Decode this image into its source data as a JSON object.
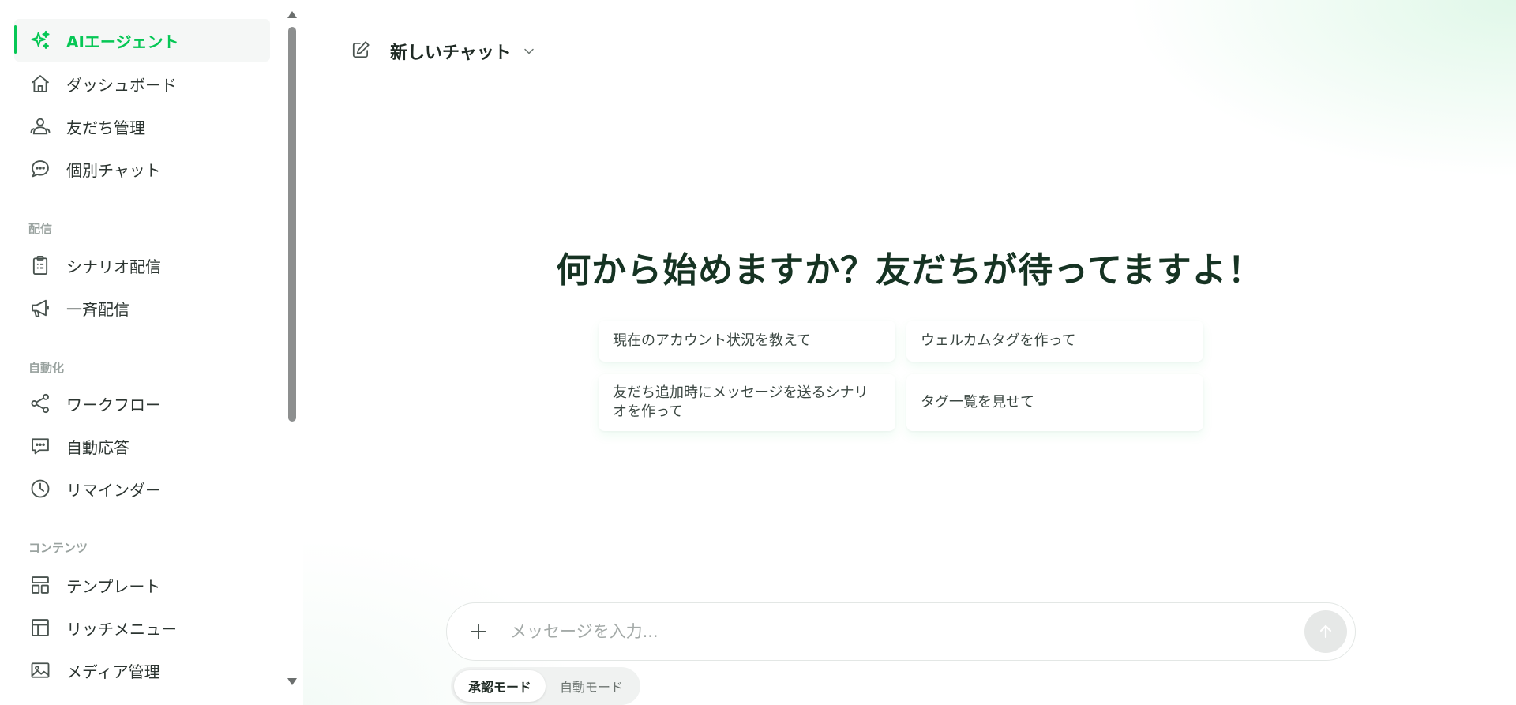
{
  "sidebar": {
    "items": [
      {
        "label": "AIエージェント",
        "icon": "sparkle-icon",
        "active": true
      },
      {
        "label": "ダッシュボード",
        "icon": "home-icon"
      },
      {
        "label": "友だち管理",
        "icon": "users-icon"
      },
      {
        "label": "個別チャット",
        "icon": "chat-bubble-icon"
      },
      {
        "label": "シナリオ配信",
        "icon": "clipboard-icon"
      },
      {
        "label": "一斉配信",
        "icon": "megaphone-icon"
      },
      {
        "label": "ワークフロー",
        "icon": "share-nodes-icon"
      },
      {
        "label": "自動応答",
        "icon": "message-square-icon"
      },
      {
        "label": "リマインダー",
        "icon": "clock-icon"
      },
      {
        "label": "テンプレート",
        "icon": "layout-template-icon"
      },
      {
        "label": "リッチメニュー",
        "icon": "grid-layout-icon"
      },
      {
        "label": "メディア管理",
        "icon": "image-icon"
      }
    ],
    "sections": {
      "delivery": "配信",
      "automation": "自動化",
      "content": "コンテンツ"
    },
    "accent_color": "#06c755"
  },
  "chat": {
    "title": "新しいチャット",
    "headline": "何から始めますか？友だちが待ってますよ！",
    "suggestions": [
      "現在のアカウント状況を教えて",
      "ウェルカムタグを作って",
      "友だち追加時にメッセージを送るシナリオを作って",
      "タグ一覧を見せて"
    ],
    "input": {
      "placeholder": "メッセージを入力...",
      "value": ""
    },
    "modes": {
      "approval": "承認モード",
      "auto": "自動モード",
      "selected": "承認モード"
    }
  }
}
